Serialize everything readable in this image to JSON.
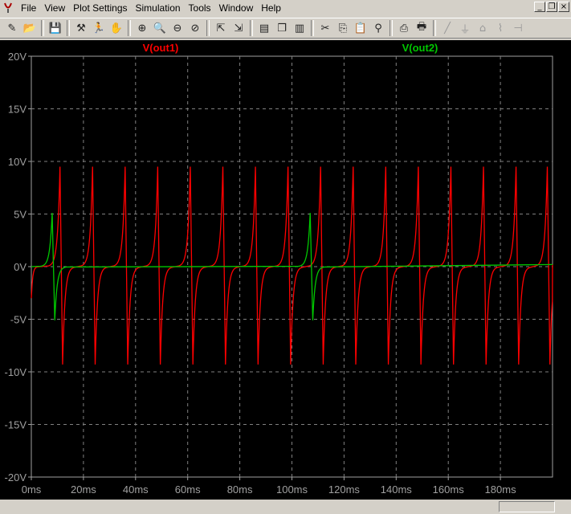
{
  "menu": {
    "items": [
      "File",
      "View",
      "Plot Settings",
      "Simulation",
      "Tools",
      "Window",
      "Help"
    ]
  },
  "window_controls": [
    "minimize-icon",
    "restore-icon",
    "close-icon"
  ],
  "toolbar": {
    "buttons": [
      "new-schematic-icon",
      "open-icon",
      "sep",
      "save-icon",
      "sep",
      "control-panel-icon",
      "run-icon",
      "halt-icon",
      "sep",
      "zoom-area-icon",
      "zoom-in-icon",
      "zoom-out-icon",
      "zoom-cancel-icon",
      "sep",
      "autorange-icon",
      "zoom-full-icon",
      "sep",
      "tile-horizontal-icon",
      "cascade-icon",
      "tile-vertical-icon",
      "sep",
      "cut-icon",
      "copy-icon",
      "paste-icon",
      "find-icon",
      "sep",
      "print-setup-icon",
      "print-icon",
      "sep",
      "wire-icon",
      "ground-icon",
      "label-icon",
      "resistor-icon",
      "capacitor-icon"
    ],
    "dim_buttons": [
      "wire-icon",
      "ground-icon",
      "label-icon",
      "resistor-icon",
      "capacitor-icon"
    ]
  },
  "chart_data": {
    "type": "line",
    "title": "",
    "xlabel": "",
    "ylabel": "",
    "xlim": [
      0,
      200
    ],
    "ylim": [
      -20,
      20
    ],
    "x_unit": "ms",
    "y_unit": "V",
    "x_ticks": [
      "0ms",
      "20ms",
      "40ms",
      "60ms",
      "80ms",
      "100ms",
      "120ms",
      "140ms",
      "160ms",
      "180ms"
    ],
    "x_tick_values": [
      0,
      20,
      40,
      60,
      80,
      100,
      120,
      140,
      160,
      180
    ],
    "y_ticks": [
      "20V",
      "15V",
      "10V",
      "5V",
      "0V",
      "-5V",
      "-10V",
      "-15V",
      "-20V"
    ],
    "y_tick_values": [
      20,
      15,
      10,
      5,
      0,
      -5,
      -10,
      -15,
      -20
    ],
    "grid": true,
    "series": [
      {
        "name": "V(out1)",
        "color": "#ff0000",
        "shape": "spike-pairs",
        "positive_spikes_ms": [
          11.0,
          23.5,
          36.0,
          48.5,
          61.0,
          73.5,
          86.0,
          98.5,
          111.0,
          123.5,
          136.0,
          148.5,
          161.0,
          173.5,
          186.0,
          198.0
        ],
        "negative_spikes_ms": [
          12.0,
          24.5,
          37.0,
          49.5,
          62.0,
          74.5,
          87.0,
          99.5,
          112.0,
          124.5,
          137.0,
          149.5,
          162.0,
          174.5,
          187.0,
          199.0
        ],
        "peak_v": 9.5,
        "trough_v": -9.3,
        "initial_v": -3.0
      },
      {
        "name": "V(out2)",
        "color": "#00c800",
        "shape": "spike-pairs",
        "positive_spikes_ms": [
          8.0,
          107.0
        ],
        "negative_spikes_ms": [
          9.0,
          108.0
        ],
        "peak_v": 5.1,
        "trough_v": -5.1,
        "initial_v": 0.0
      }
    ]
  }
}
